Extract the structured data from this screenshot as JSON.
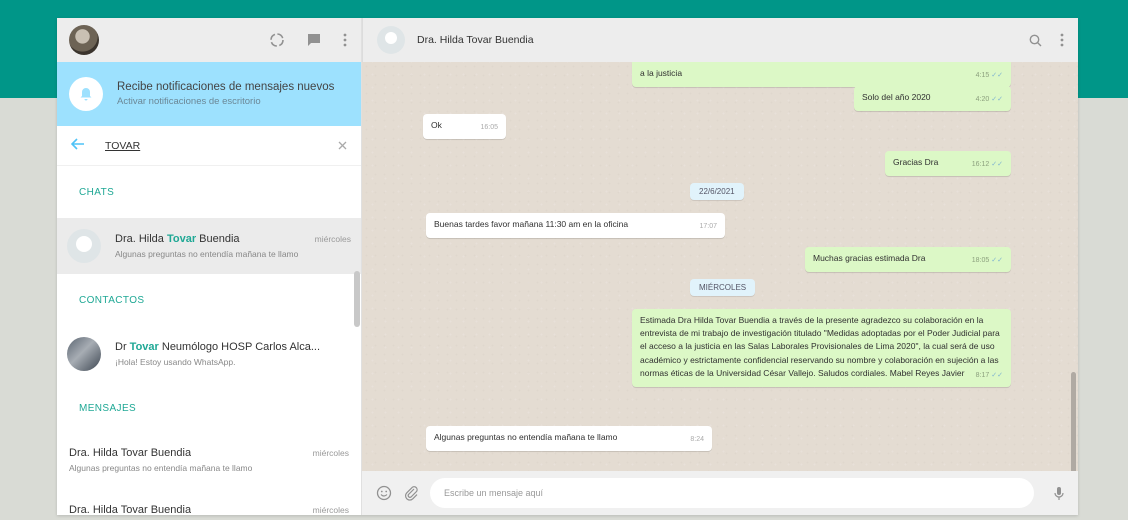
{
  "left": {
    "notification": {
      "title": "Recibe notificaciones de mensajes nuevos",
      "subtitle": "Activar notificaciones de escritorio"
    },
    "search": {
      "query": "TOVAR"
    },
    "sections": {
      "chats": "CHATS",
      "contacts": "CONTACTOS",
      "messages": "MENSAJES"
    },
    "chats": [
      {
        "name_prefix": "Dra. Hilda ",
        "name_highlight": "Tovar",
        "name_suffix": " Buendia",
        "time": "miércoles",
        "preview": "Algunas preguntas no entendía mañana te llamo"
      }
    ],
    "contacts": [
      {
        "name_prefix": "Dr ",
        "name_highlight": "Tovar",
        "name_suffix": " Neumólogo HOSP Carlos Alca...",
        "preview": "¡Hola! Estoy usando WhatsApp."
      }
    ],
    "messages": [
      {
        "name": "Dra. Hilda Tovar Buendia",
        "time": "miércoles",
        "preview": "Algunas preguntas no entendía mañana te llamo"
      },
      {
        "name": "Dra. Hilda Tovar Buendia",
        "time": "miércoles",
        "preview": ""
      }
    ]
  },
  "right": {
    "contact_name": "Dra. Hilda Tovar Buendia",
    "messages": [
      {
        "id": "m1",
        "dir": "out",
        "text": "a la justicia",
        "time": "4:15"
      },
      {
        "id": "m2",
        "dir": "out",
        "text": "Solo del año 2020",
        "time": "4:20"
      },
      {
        "id": "m3",
        "dir": "in",
        "text": "Ok",
        "time": "16:05"
      },
      {
        "id": "m4",
        "dir": "out",
        "text": "Gracias Dra",
        "time": "16:12"
      },
      {
        "id": "m5",
        "dir": "in",
        "text": "Buenas tardes favor mañana 11:30 am en la oficina",
        "time": "17:07"
      },
      {
        "id": "m6",
        "dir": "out",
        "text": "Muchas gracias estimada Dra",
        "time": "18:05"
      },
      {
        "id": "m7",
        "dir": "out",
        "text": "Estimada Dra Hilda Tovar Buendia a través de la presente agradezco su colaboración en la entrevista de mi trabajo de investigación titulado \"Medidas adoptadas por el Poder Judicial para el acceso a la justicia en las Salas Laborales Provisionales de Lima 2020\", la cual será de uso académico y estrictamente confidencial reservando su nombre y colaboración en sujeción a las normas éticas de la Universidad César Vallejo. Saludos cordiales. Mabel Reyes Javier",
        "time": "8:17"
      },
      {
        "id": "m8",
        "dir": "in",
        "text": "Algunas preguntas no entendía mañana te llamo",
        "time": "8:24"
      }
    ],
    "dates": {
      "d1": "22/6/2021",
      "d2": "MIÉRCOLES"
    },
    "composer_placeholder": "Escribe un mensaje aquí"
  }
}
